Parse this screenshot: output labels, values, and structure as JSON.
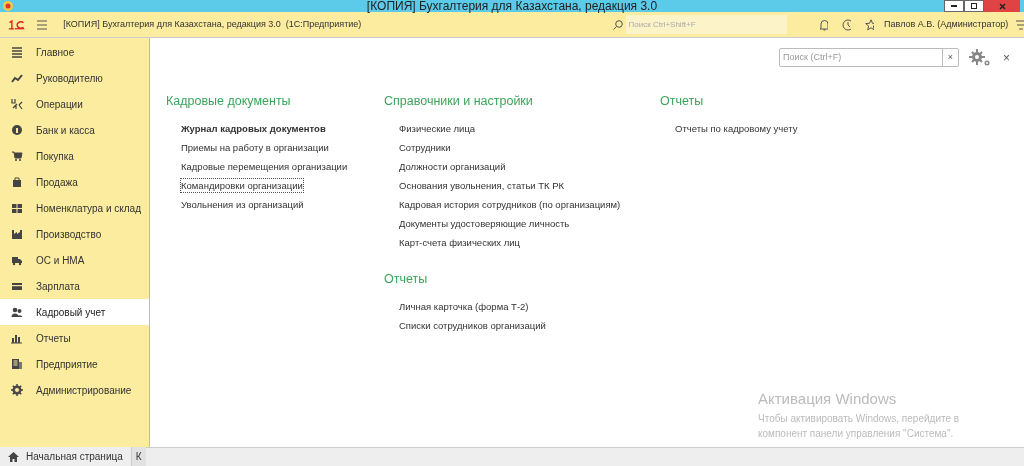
{
  "window": {
    "title": "[КОПИЯ] Бухгалтерия для Казахстана, редакция 3.0"
  },
  "toolbar": {
    "app_title": "[КОПИЯ] Бухгалтерия для Казахстана, редакция 3.0  (1С:Предприятие)",
    "search": {
      "placeholder": "Поиск Ctrl+Shift+F"
    },
    "user": "Павлов А.В. (Администратор)"
  },
  "sidebar": {
    "items": [
      {
        "label": "Главное",
        "selected": false
      },
      {
        "label": "Руководителю",
        "selected": false
      },
      {
        "label": "Операции",
        "selected": false
      },
      {
        "label": "Банк и касса",
        "selected": false
      },
      {
        "label": "Покупка",
        "selected": false
      },
      {
        "label": "Продажа",
        "selected": false
      },
      {
        "label": "Номенклатура и склад",
        "selected": false
      },
      {
        "label": "Производство",
        "selected": false
      },
      {
        "label": "ОС и НМА",
        "selected": false
      },
      {
        "label": "Зарплата",
        "selected": false
      },
      {
        "label": "Кадровый учет",
        "selected": true
      },
      {
        "label": "Отчеты",
        "selected": false
      },
      {
        "label": "Предприятие",
        "selected": false
      },
      {
        "label": "Администрирование",
        "selected": false
      }
    ]
  },
  "panel": {
    "search": {
      "placeholder": "Поиск (Ctrl+F)",
      "clear": "×"
    },
    "close": "×",
    "columns": [
      {
        "sections": [
          {
            "title": "Кадровые документы",
            "links": [
              {
                "label": "Журнал кадровых документов",
                "important": true,
                "focused": false
              },
              {
                "label": "Приемы на работу в организации",
                "important": false,
                "focused": false
              },
              {
                "label": "Кадровые перемещения организации",
                "important": false,
                "focused": false
              },
              {
                "label": "Командировки организации",
                "important": false,
                "focused": true
              },
              {
                "label": "Увольнения из организаций",
                "important": false,
                "focused": false
              }
            ]
          }
        ]
      },
      {
        "sections": [
          {
            "title": "Справочники и настройки",
            "links": [
              {
                "label": "Физические лица",
                "important": false,
                "focused": false
              },
              {
                "label": "Сотрудники",
                "important": false,
                "focused": false
              },
              {
                "label": "Должности организаций",
                "important": false,
                "focused": false
              },
              {
                "label": "Основания увольнения, статьи ТК РК",
                "important": false,
                "focused": false
              },
              {
                "label": "Кадровая история сотрудников (по организациям)",
                "important": false,
                "focused": false
              },
              {
                "label": "Документы удостоверяющие личность",
                "important": false,
                "focused": false
              },
              {
                "label": "Карт-счета физических лиц",
                "important": false,
                "focused": false
              }
            ]
          },
          {
            "title": "Отчеты",
            "links": [
              {
                "label": "Личная карточка (форма Т-2)",
                "important": false,
                "focused": false
              },
              {
                "label": "Списки сотрудников организаций",
                "important": false,
                "focused": false
              }
            ]
          }
        ]
      },
      {
        "sections": [
          {
            "title": "Отчеты",
            "links": [
              {
                "label": "Отчеты по кадровому учету",
                "important": false,
                "focused": false
              }
            ]
          }
        ]
      }
    ]
  },
  "os_notice": {
    "title": "Активация Windows",
    "text": "Чтобы активировать Windows, перейдите в компонент панели управления \"Система\"."
  },
  "open_tabs": [
    {
      "label": "Начальная страница",
      "selected": true
    },
    {
      "label": "К",
      "selected": false
    }
  ]
}
